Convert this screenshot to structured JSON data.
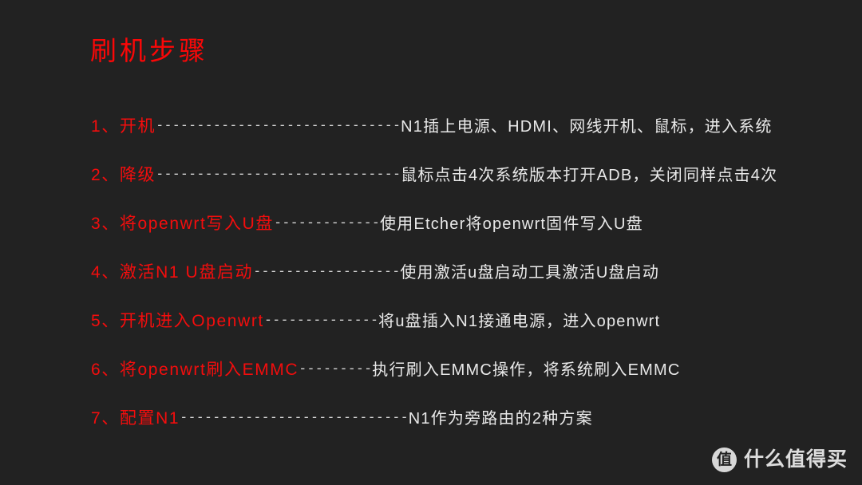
{
  "slide": {
    "background_color": "#222222",
    "accent_color": "#f40d0d",
    "text_color": "#e9e9e9",
    "title": "刷机步骤"
  },
  "steps": [
    {
      "label": "1、开机",
      "connector": "------------------------------",
      "desc": "N1插上电源、HDMI、网线开机、鼠标，进入系统"
    },
    {
      "label": "2、降级",
      "connector": "------------------------------",
      "desc": "鼠标点击4次系统版本打开ADB，关闭同样点击4次"
    },
    {
      "label": "3、将openwrt写入U盘",
      "connector": "-------------",
      "desc": "使用Etcher将openwrt固件写入U盘"
    },
    {
      "label": "4、激活N1 U盘启动",
      "connector": "------------------",
      "desc": "使用激活u盘启动工具激活U盘启动"
    },
    {
      "label": "5、开机进入Openwrt",
      "connector": "--------------",
      "desc": "将u盘插入N1接通电源，进入openwrt"
    },
    {
      "label": "6、将openwrt刷入EMMC",
      "connector": "---------",
      "desc": "执行刷入EMMC操作，将系统刷入EMMC"
    },
    {
      "label": "7、配置N1",
      "connector": "----------------------------",
      "desc": "N1作为旁路由的2种方案"
    }
  ],
  "watermark": {
    "logo_glyph": "值",
    "text": "什么值得买"
  }
}
